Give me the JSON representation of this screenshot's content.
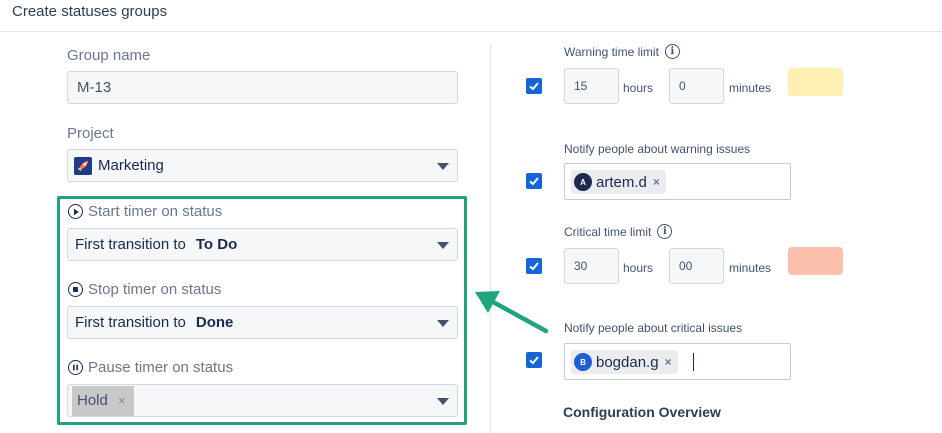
{
  "header": {
    "title": "Create statuses groups"
  },
  "left": {
    "group_name": {
      "label": "Group name",
      "value": "M-13"
    },
    "project": {
      "label": "Project",
      "value": "Marketing",
      "icon": "rocket-icon"
    },
    "start": {
      "label": "Start timer on status",
      "prefix": "First transition to",
      "status": "To Do",
      "icon": "play-circle-icon"
    },
    "stop": {
      "label": "Stop timer on status",
      "prefix": "First transition to",
      "status": "Done",
      "icon": "stop-circle-icon"
    },
    "pause": {
      "label": "Pause timer on status",
      "chip": "Hold",
      "chip_remove": "×",
      "icon": "pause-circle-icon"
    }
  },
  "right": {
    "warning": {
      "label": "Warning time limit",
      "checked": true,
      "hours": "15",
      "hours_unit": "hours",
      "minutes": "0",
      "minutes_unit": "minutes",
      "color": "#fdf0b2"
    },
    "notify_warning": {
      "label": "Notify people about warning issues",
      "checked": true,
      "user": "artem.d",
      "avatar_initial": "A",
      "avatar_color": "#1d2b4f",
      "remove": "×"
    },
    "critical": {
      "label": "Critical time limit",
      "checked": true,
      "hours": "30",
      "hours_unit": "hours",
      "minutes": "00",
      "minutes_unit": "minutes",
      "color": "#fbc0ac"
    },
    "notify_critical": {
      "label": "Notify people about critical issues",
      "checked": true,
      "user": "bogdan.g",
      "avatar_initial": "B",
      "avatar_color": "#1f5fd1",
      "remove": "×"
    },
    "config_title": "Configuration Overview"
  },
  "colors": {
    "highlight": "#1fa47e",
    "checkbox": "#1565d8"
  }
}
